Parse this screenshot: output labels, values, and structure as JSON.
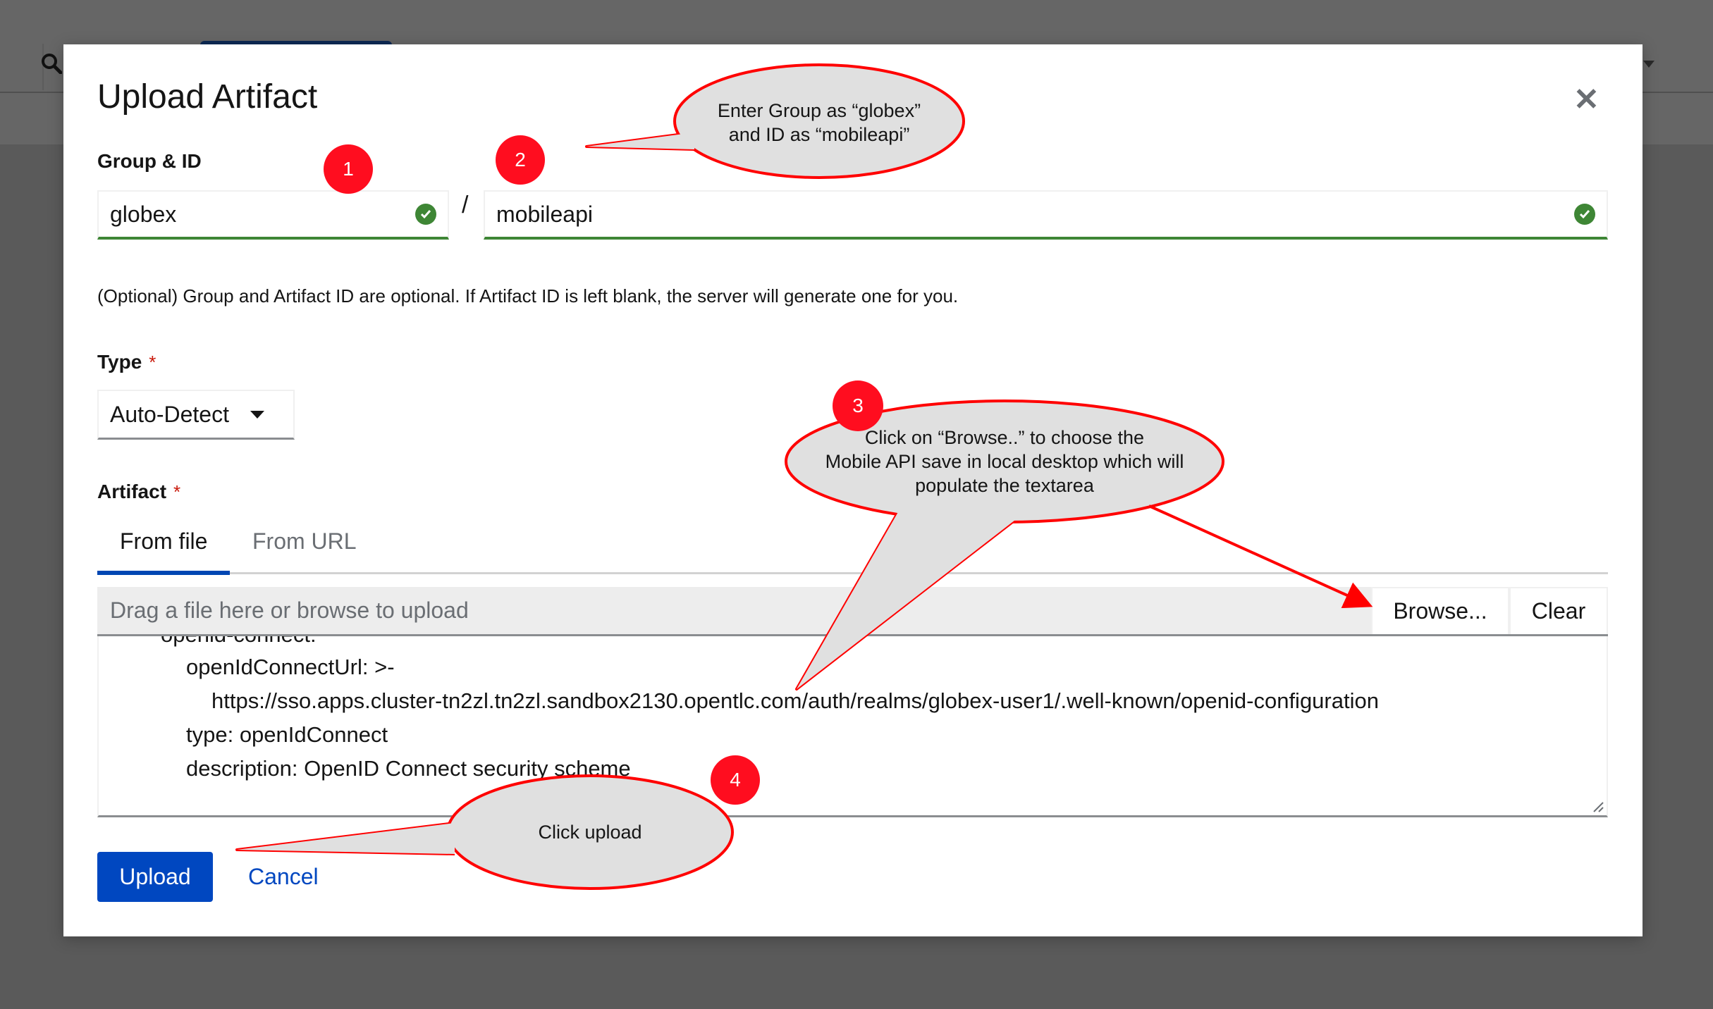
{
  "background": {
    "search_icon": "search-icon"
  },
  "modal": {
    "title": "Upload Artifact",
    "close_icon": "close-icon",
    "group_id": {
      "label": "Group & ID",
      "group_value": "globex",
      "separator": "/",
      "id_value": "mobileapi",
      "status_icon": "check-circle-icon",
      "status_color": "#3e8635"
    },
    "helper_text": "(Optional) Group and Artifact ID are optional. If Artifact ID is left blank, the server will generate one for you.",
    "type": {
      "label": "Type",
      "required_marker": "*",
      "selected": "Auto-Detect"
    },
    "artifact": {
      "label": "Artifact",
      "required_marker": "*",
      "tabs": [
        {
          "label": "From file",
          "active": true
        },
        {
          "label": "From URL",
          "active": false
        }
      ],
      "file_placeholder": "Drag a file here or browse to upload",
      "browse_label": "Browse...",
      "clear_label": "Clear",
      "content_lines": [
        "openid-connect:",
        "openIdConnectUrl: >-",
        "https://sso.apps.cluster-tn2zl.tn2zl.sandbox2130.opentlc.com/auth/realms/globex-user1/.well-known/openid-configuration",
        "type: openIdConnect",
        "description: OpenID Connect security scheme"
      ]
    },
    "footer": {
      "upload_label": "Upload",
      "cancel_label": "Cancel"
    },
    "accent_color": "#0047c0"
  },
  "annotations": {
    "color": "#ff0000",
    "bubble_fill": "#e0e0e0",
    "steps": [
      {
        "number": "1"
      },
      {
        "number": "2",
        "text_lines": [
          "Enter Group as “globex”",
          "and ID as “mobileapi”"
        ]
      },
      {
        "number": "3",
        "text_lines": [
          "Click on “Browse..” to choose the",
          "Mobile API save in local desktop which will",
          "populate the textarea"
        ]
      },
      {
        "number": "4",
        "text_lines": [
          "Click upload"
        ]
      }
    ]
  }
}
